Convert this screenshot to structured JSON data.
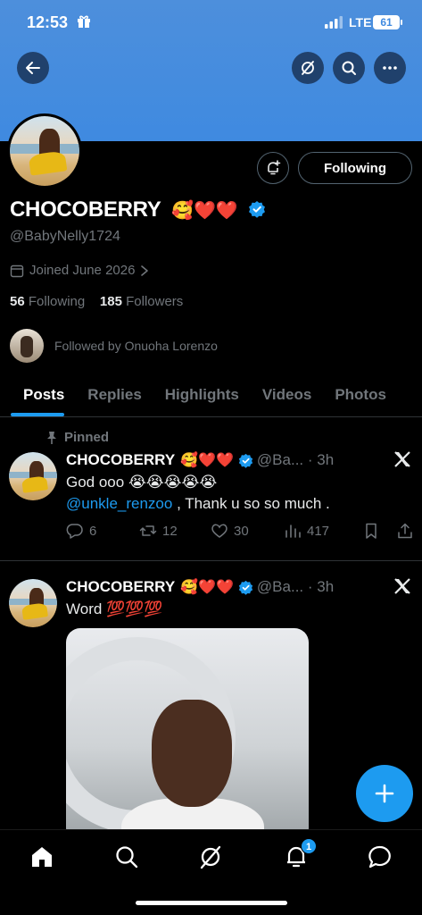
{
  "status": {
    "time": "12:53",
    "network": "LTE",
    "battery": "61"
  },
  "profile": {
    "name": "CHOCOBERRY",
    "name_emoji": "🥰❤️❤️",
    "handle": "@BabyNelly1724",
    "joined": "Joined June 2026",
    "following_count": "56",
    "following_label": "Following",
    "followers_count": "185",
    "followers_label": "Followers",
    "followed_by": "Followed by Onuoha Lorenzo",
    "follow_button": "Following"
  },
  "tabs": [
    {
      "label": "Posts"
    },
    {
      "label": "Replies"
    },
    {
      "label": "Highlights"
    },
    {
      "label": "Videos"
    },
    {
      "label": "Photos"
    }
  ],
  "posts": [
    {
      "pinned_label": "Pinned",
      "name": "CHOCOBERRY",
      "name_emoji": "🥰❤️❤️",
      "meta": "@Ba... · 3h",
      "text": "God ooo 😭😭😭😭😭",
      "mention": "@unkle_renzoo",
      "text2": " , Thank u so so much .",
      "replies": "6",
      "reposts": "12",
      "likes": "30",
      "views": "417"
    },
    {
      "name": "CHOCOBERRY",
      "name_emoji": "🥰❤️❤️",
      "meta": "@Ba... · 3h",
      "text": "Word 💯💯💯"
    }
  ],
  "notifications_badge": "1",
  "colors": {
    "accent": "#1d9bf0",
    "banner": "#3f8ae0",
    "background": "#000000"
  }
}
